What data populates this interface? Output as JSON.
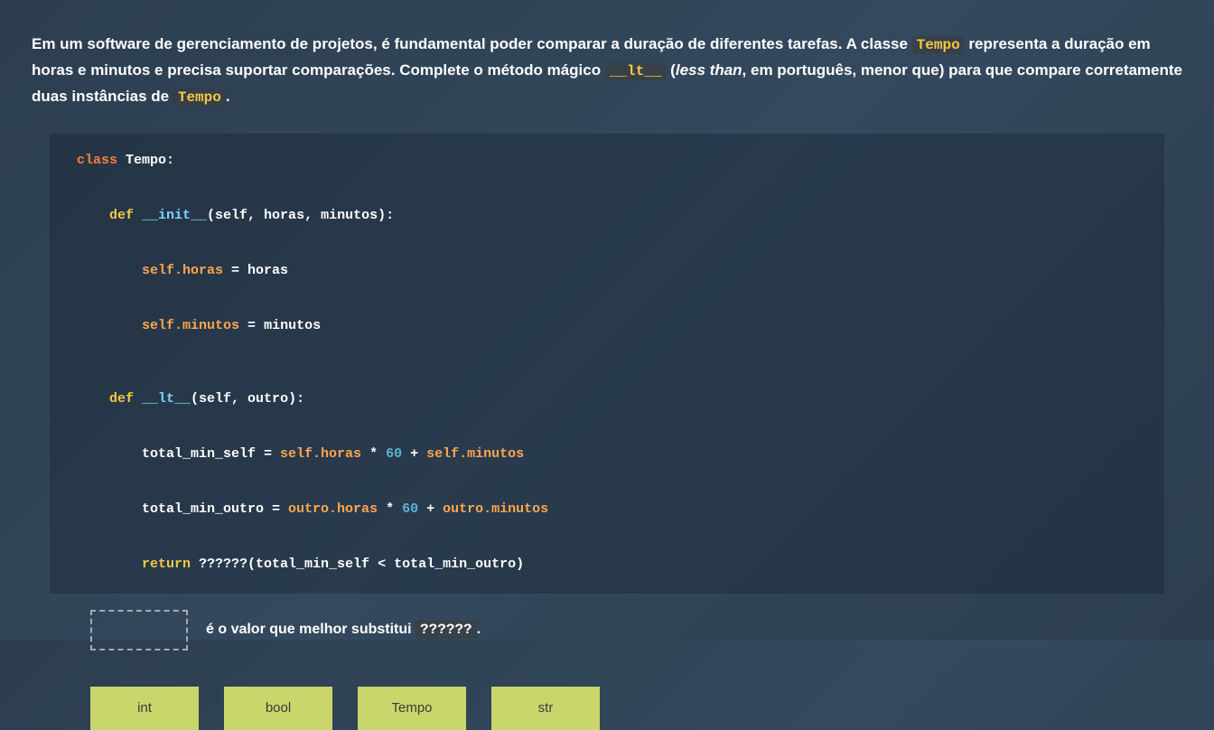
{
  "question": {
    "part1": "Em um software de gerenciamento de projetos, é fundamental poder comparar a duração de diferentes tarefas. A classe ",
    "code1": "Tempo",
    "part2": " representa a duração em horas e minutos e precisa suportar comparações. Complete o método mágico ",
    "code2": "__lt__",
    "part3": " (",
    "italic": "less than",
    "part4": ", em português, menor que) para que compare corretamente duas instâncias de ",
    "code3": "Tempo",
    "part5": "."
  },
  "code": {
    "kw_class": "class",
    "class_name": " Tempo",
    "colon": ":",
    "kw_def": "def",
    "init_name": " __init__",
    "init_params": "(self, horas, minutos)",
    "line_assign1_a": "self.horas",
    "line_assign1_b": " = ",
    "line_assign1_c": "horas",
    "line_assign2_a": "self.minutos",
    "line_assign2_b": " = ",
    "line_assign2_c": "minutos",
    "lt_name": " __lt__",
    "lt_params": "(self, outro)",
    "calc1_a": "total_min_self = ",
    "calc1_b": "self.horas",
    "calc1_c": " * ",
    "calc1_num": "60",
    "calc1_d": " + ",
    "calc1_e": "self.minutos",
    "calc2_a": "total_min_outro = ",
    "calc2_b": "outro.horas",
    "calc2_c": " * ",
    "calc2_num": "60",
    "calc2_d": " + ",
    "calc2_e": "outro.minutos",
    "kw_return": "return",
    "return_expr": " ??????(total_min_self < total_min_outro)"
  },
  "answer": {
    "label_part1": "é o valor que melhor substitui ",
    "label_code": "??????",
    "label_part2": "."
  },
  "options": {
    "opt1": "int",
    "opt2": "bool",
    "opt3": "Tempo",
    "opt4": "str"
  }
}
